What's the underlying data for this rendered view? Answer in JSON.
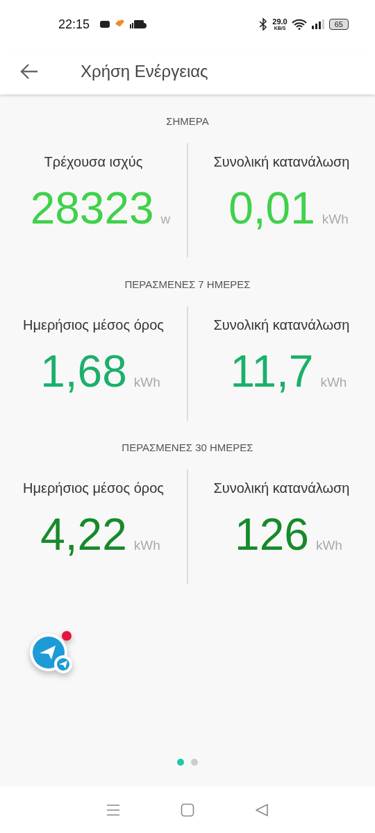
{
  "status_bar": {
    "time": "22:15",
    "speed": "29.0",
    "speed_unit": "KB/S",
    "battery": "65"
  },
  "app_bar": {
    "title": "Χρήση Ενέργειας"
  },
  "sections": [
    {
      "title": "ΣΗΜΕΡΑ",
      "color": "#3fd14a",
      "stats": [
        {
          "label": "Τρέχουσα ισχύς",
          "value": "28323",
          "unit": "w"
        },
        {
          "label": "Συνολική κατανάλωση",
          "value": "0,01",
          "unit": "kWh"
        }
      ]
    },
    {
      "title": "ΠΕΡΑΣΜΕΝΕΣ 7 ΗΜΕΡΕΣ",
      "color": "#1bb06a",
      "stats": [
        {
          "label": "Ημερήσιος μέσος όρος",
          "value": "1,68",
          "unit": "kWh"
        },
        {
          "label": "Συνολική κατανάλωση",
          "value": "11,7",
          "unit": "kWh"
        }
      ]
    },
    {
      "title": "ΠΕΡΑΣΜΕΝΕΣ 30 ΗΜΕΡΕΣ",
      "color": "#168a2a",
      "stats": [
        {
          "label": "Ημερήσιος μέσος όρος",
          "value": "4,22",
          "unit": "kWh"
        },
        {
          "label": "Συνολική κατανάλωση",
          "value": "126",
          "unit": "kWh"
        }
      ]
    }
  ],
  "page_dots": [
    {
      "selected": true
    },
    {
      "selected": false
    }
  ]
}
